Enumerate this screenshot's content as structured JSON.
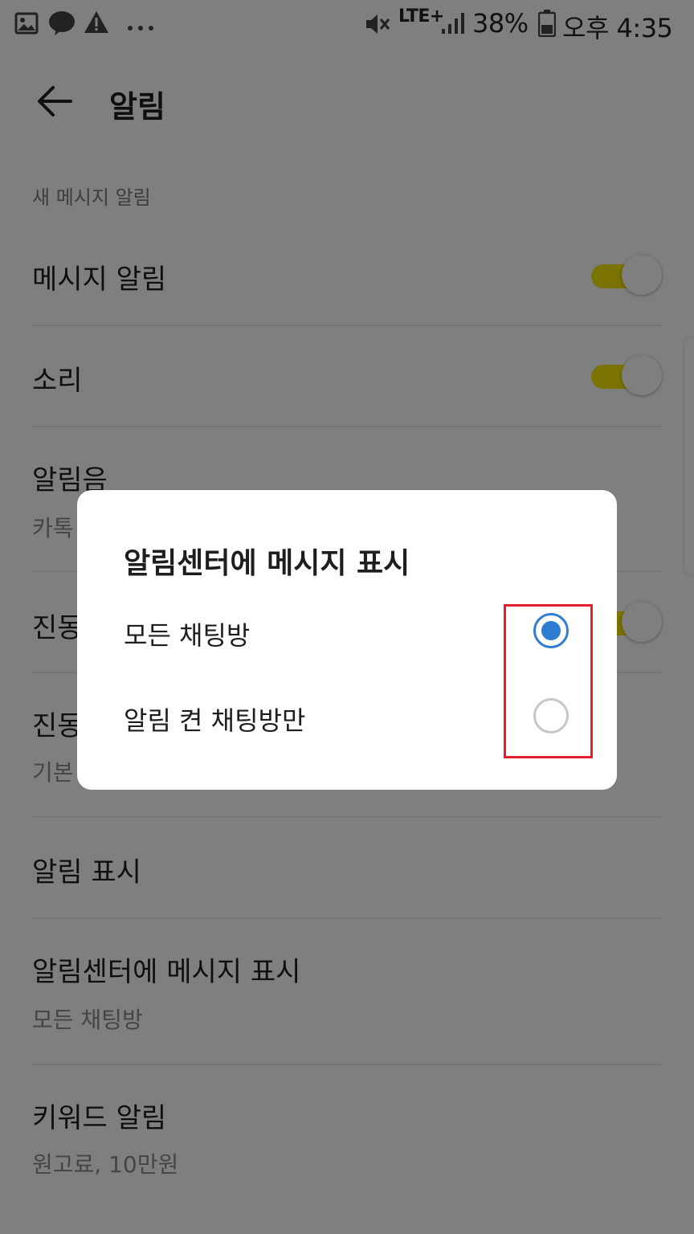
{
  "status_bar": {
    "battery": "38%",
    "time": "오후 4:35",
    "network": "LTE+"
  },
  "app_bar": {
    "title": "알림"
  },
  "settings": {
    "section_header": "새 메시지 알림",
    "items": [
      {
        "title": "메시지 알림",
        "toggle": true
      },
      {
        "title": "소리",
        "toggle": true
      },
      {
        "title": "알림음",
        "subtitle": "카톡"
      },
      {
        "title": "진동",
        "toggle": true
      },
      {
        "title": "진동",
        "subtitle": "기본"
      },
      {
        "title": "알림 표시"
      },
      {
        "title": "알림센터에 메시지 표시",
        "subtitle": "모든 채팅방"
      },
      {
        "title": "키워드 알림",
        "subtitle": "원고료, 10만원"
      }
    ]
  },
  "dialog": {
    "title": "알림센터에 메시지 표시",
    "options": [
      {
        "label": "모든 채팅방",
        "selected": true
      },
      {
        "label": "알림 켠 채팅방만",
        "selected": false
      }
    ]
  },
  "colors": {
    "toggle_on": "#f7e600",
    "radio_selected": "#2f7cd3",
    "highlight": "#e0202a"
  }
}
